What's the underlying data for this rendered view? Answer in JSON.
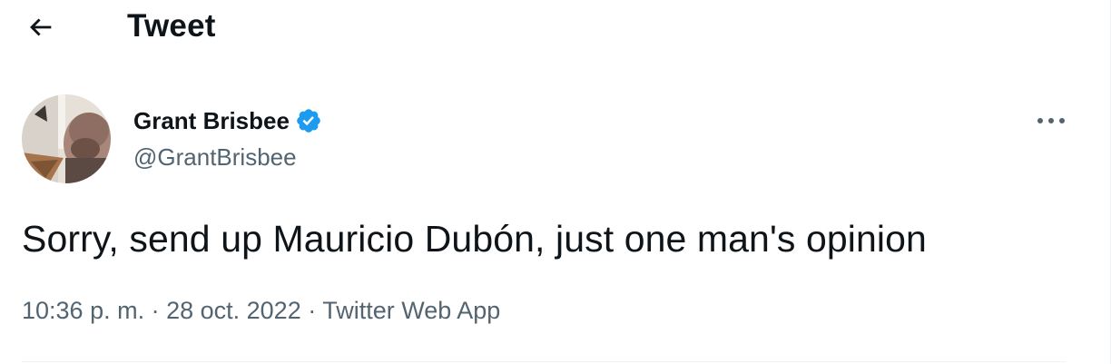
{
  "header": {
    "title": "Tweet",
    "back_icon": "arrow-left-icon"
  },
  "author": {
    "display_name": "Grant Brisbee",
    "handle": "@GrantBrisbee",
    "verified": true,
    "verified_icon": "verified-badge-icon",
    "verified_color": "#1d9bf0"
  },
  "more_icon": "more-horizontal-icon",
  "tweet": {
    "text": "Sorry, send up Mauricio Dubón, just one man's opinion"
  },
  "meta": {
    "time": "10:36 p. m.",
    "separator": " · ",
    "date": "28 oct. 2022",
    "source": "Twitter Web App"
  },
  "colors": {
    "primary_text": "#0f1419",
    "secondary_text": "#536471",
    "divider": "#eff3f4"
  }
}
